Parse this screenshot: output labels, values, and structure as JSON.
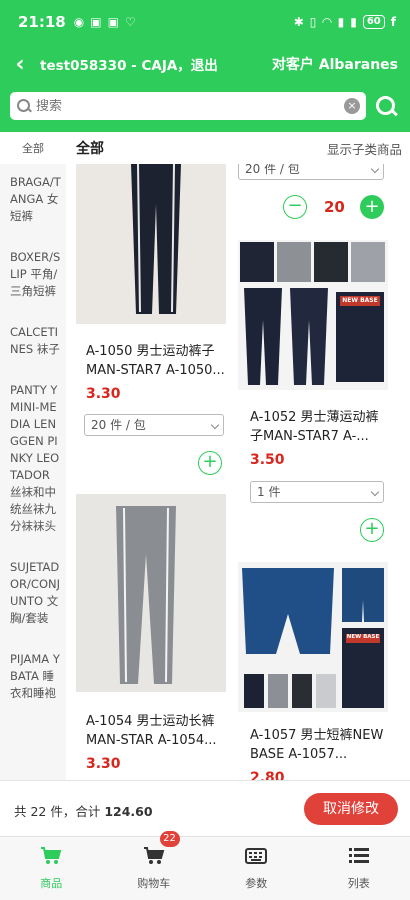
{
  "status_bar": {
    "time": "21:18",
    "battery": "60"
  },
  "header": {
    "back_icon": "chevron-left-icon",
    "title": "test058330 - CAJA，退出",
    "right_label": "对客户 Albaranes"
  },
  "search": {
    "placeholder": "搜索"
  },
  "category_bar": {
    "side_all": "全部",
    "all": "全部",
    "show_sub": "显示子类商品"
  },
  "sidebar": {
    "items": [
      "BRAGA/TANGA 女短裤",
      "BOXER/SLIP 平角/三角短裤",
      "CALCETINES 袜子",
      "PANTY Y MINI-MEDIA LENGGEN PINKY LEOTADOR 丝袜和中统丝袜九分袜袜头",
      "SUJETADOR/CONJUNTO 文胸/套装",
      "PIJAMA Y BATA 睡衣和睡袍"
    ]
  },
  "products": [
    {
      "name": "A-1050 男士运动裤子MAN-STAR7 A-1050...",
      "price": "3.30",
      "unit": "20 件 / 包",
      "image_text": ""
    },
    {
      "name": "",
      "price": "",
      "unit": "20 件 / 包",
      "qty": "20",
      "image_text": ""
    },
    {
      "name": "A-1052 男士薄运动裤子MAN-STAR7 A-...",
      "price": "3.50",
      "unit": "1 件",
      "image_text": "NEW BASE"
    },
    {
      "name": "A-1054 男士运动长裤MAN-STAR A-1054...",
      "price": "3.30",
      "unit": "",
      "image_text": ""
    },
    {
      "name": "A-1057 男士短裤NEW BASE A-1057...",
      "price": "2.80",
      "unit": "",
      "image_text": "NEW BASE"
    }
  ],
  "totals": {
    "prefix": "共 22 件，合计",
    "amount": "124.60",
    "cancel_label": "取消修改"
  },
  "nav": {
    "items": [
      {
        "label": "商品",
        "icon": "cart-icon"
      },
      {
        "label": "购物车",
        "icon": "cart-icon",
        "badge": "22"
      },
      {
        "label": "参数",
        "icon": "keyboard-icon"
      },
      {
        "label": "列表",
        "icon": "list-icon"
      }
    ]
  },
  "colors": {
    "primary": "#2ecc5a",
    "price": "#d9261c",
    "cancel": "#e0423a"
  }
}
